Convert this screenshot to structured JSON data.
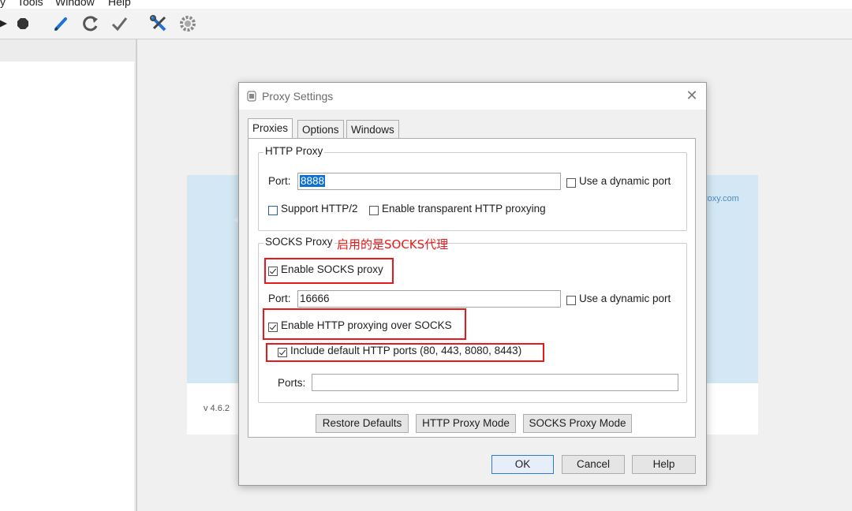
{
  "menubar": {
    "items": [
      "y",
      "Tools",
      "Window",
      "Help"
    ]
  },
  "toolbar": {
    "icons": [
      "play-icon",
      "stop-icon",
      "pencil-icon",
      "refresh-icon",
      "check-icon",
      "tools-icon",
      "settings-gear-icon"
    ]
  },
  "background": {
    "version": "v 4.6.2",
    "site_fragment": "roxy.com"
  },
  "dialog": {
    "title": "Proxy Settings",
    "close_glyph": "✕",
    "tabs": [
      "Proxies",
      "Options",
      "Windows"
    ],
    "active_tab": "Proxies",
    "http_proxy": {
      "legend": "HTTP Proxy",
      "port_label": "Port:",
      "port_value": "8888",
      "dynamic_port_label": "Use a dynamic port",
      "dynamic_port_checked": false,
      "support_http2_label": "Support HTTP/2",
      "support_http2_checked": false,
      "transparent_label": "Enable transparent HTTP proxying",
      "transparent_checked": false
    },
    "socks_proxy": {
      "legend": "SOCKS Proxy",
      "annotation": "启用的是SOCKS代理",
      "enable_label": "Enable SOCKS proxy",
      "enable_checked": true,
      "port_label": "Port:",
      "port_value": "16666",
      "dynamic_port_label": "Use a dynamic port",
      "dynamic_port_checked": false,
      "http_over_socks_label": "Enable HTTP proxying over SOCKS",
      "http_over_socks_checked": true,
      "include_ports_label": "Include default HTTP ports (80, 443, 8080, 8443)",
      "include_ports_checked": true,
      "ports_label": "Ports:",
      "ports_value": ""
    },
    "buttons": {
      "restore_defaults": "Restore Defaults",
      "http_proxy_mode": "HTTP Proxy Mode",
      "socks_proxy_mode": "SOCKS Proxy Mode",
      "ok": "OK",
      "cancel": "Cancel",
      "help": "Help"
    }
  },
  "colors": {
    "annotation_red": "#e8191b",
    "selection_blue": "#0d6fd1",
    "welcome_blue": "#d3e7f4"
  }
}
